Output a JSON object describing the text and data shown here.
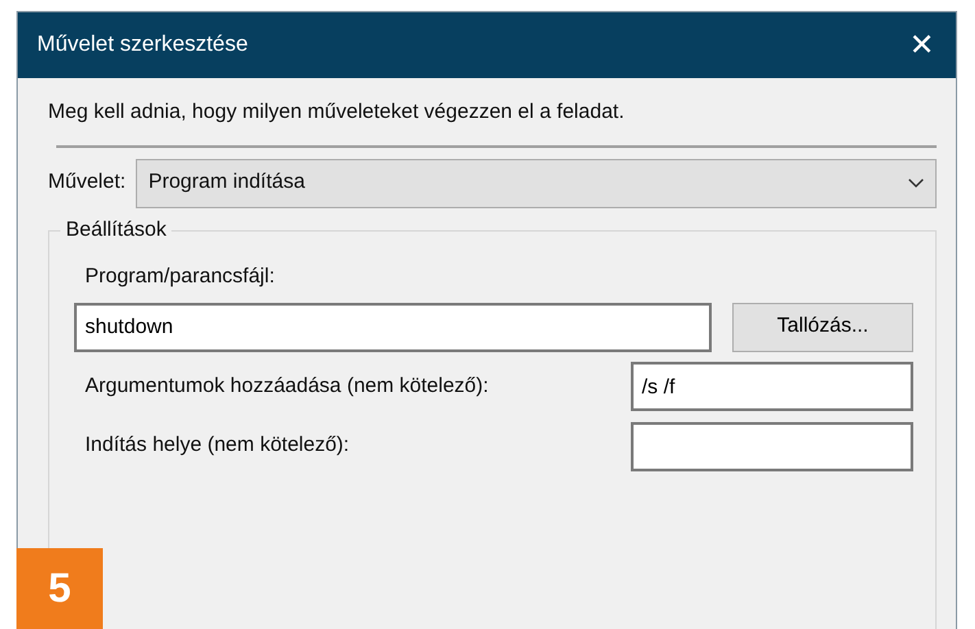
{
  "window": {
    "title": "Művelet szerkesztése",
    "close": "✕"
  },
  "instruction": "Meg kell adnia, hogy milyen műveleteket végezzen el a feladat.",
  "action": {
    "label": "Művelet:",
    "value": "Program indítása"
  },
  "group": {
    "title": "Beállítások",
    "program": {
      "label": "Program/parancsfájl:",
      "value": "shutdown",
      "button": "Tallózás..."
    },
    "fields": [
      {
        "label": "Argumentumok hozzáadása (nem kötelező):",
        "value": "/s /f"
      },
      {
        "label": "Indítás helye (nem kötelező):"
      }
    ]
  },
  "step_number": "5"
}
